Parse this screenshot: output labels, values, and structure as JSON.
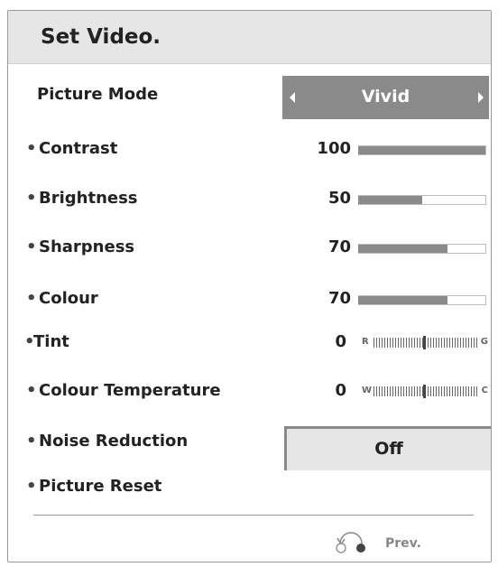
{
  "header": {
    "title": "Set Video."
  },
  "picture_mode": {
    "label": "Picture Mode",
    "value": "Vivid"
  },
  "settings": [
    {
      "label": "Contrast",
      "value": "100",
      "level": 100
    },
    {
      "label": "Brightness",
      "value": "50",
      "level": 50
    },
    {
      "label": "Sharpness",
      "value": "70",
      "level": 70
    },
    {
      "label": "Colour",
      "value": "70",
      "level": 70
    }
  ],
  "tint": {
    "label": "Tint",
    "value": "0",
    "left": "R",
    "right": "G"
  },
  "colour_temperature": {
    "label": "Colour Temperature",
    "value": "0",
    "left": "W",
    "right": "C"
  },
  "noise_reduction": {
    "label": "Noise Reduction",
    "value": "Off"
  },
  "picture_reset": {
    "label": "Picture Reset"
  },
  "footer": {
    "prev_label": "Prev."
  },
  "colors": {
    "bar_fill": "#8a8a8a",
    "header_bg": "#e6e6e6"
  }
}
